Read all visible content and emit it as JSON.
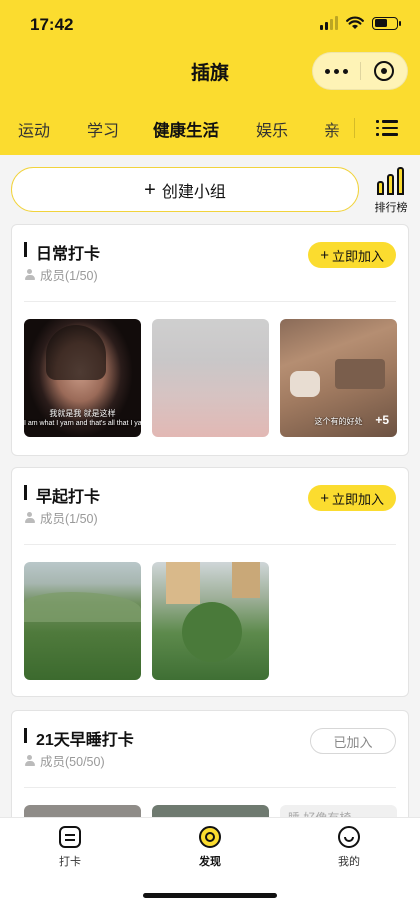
{
  "status": {
    "time": "17:42"
  },
  "nav": {
    "title": "插旗"
  },
  "tabs": [
    {
      "label": "运动"
    },
    {
      "label": "学习"
    },
    {
      "label": "健康生活",
      "active": true
    },
    {
      "label": "娱乐"
    },
    {
      "label": "亲"
    }
  ],
  "actions": {
    "create_label": "创建小组",
    "create_icon": "plus-icon",
    "rank_label": "排行榜"
  },
  "groups": [
    {
      "title": "日常打卡",
      "members": "成员(1/50)",
      "button": "立即加入",
      "joined": false,
      "photos": [
        {
          "caption_1": "我就是我 就是这样",
          "caption_2": "I am what I yarn and that's all that I yarn"
        },
        {
          "caption_1": ""
        },
        {
          "caption_1": "这个有的好处",
          "more_count": "+5"
        }
      ]
    },
    {
      "title": "早起打卡",
      "members": "成员(1/50)",
      "button": "立即加入",
      "joined": false
    },
    {
      "title": "21天早睡打卡",
      "members": "成员(50/50)",
      "button": "已加入",
      "joined": true,
      "partial_text": "睡 好像有椅"
    }
  ],
  "bottom_nav": [
    {
      "label": "打卡",
      "icon": "checkin-icon"
    },
    {
      "label": "发现",
      "icon": "discover-icon",
      "active": true
    },
    {
      "label": "我的",
      "icon": "profile-icon"
    }
  ],
  "colors": {
    "brand": "#fbdc2f",
    "background": "#f4f4f4"
  }
}
